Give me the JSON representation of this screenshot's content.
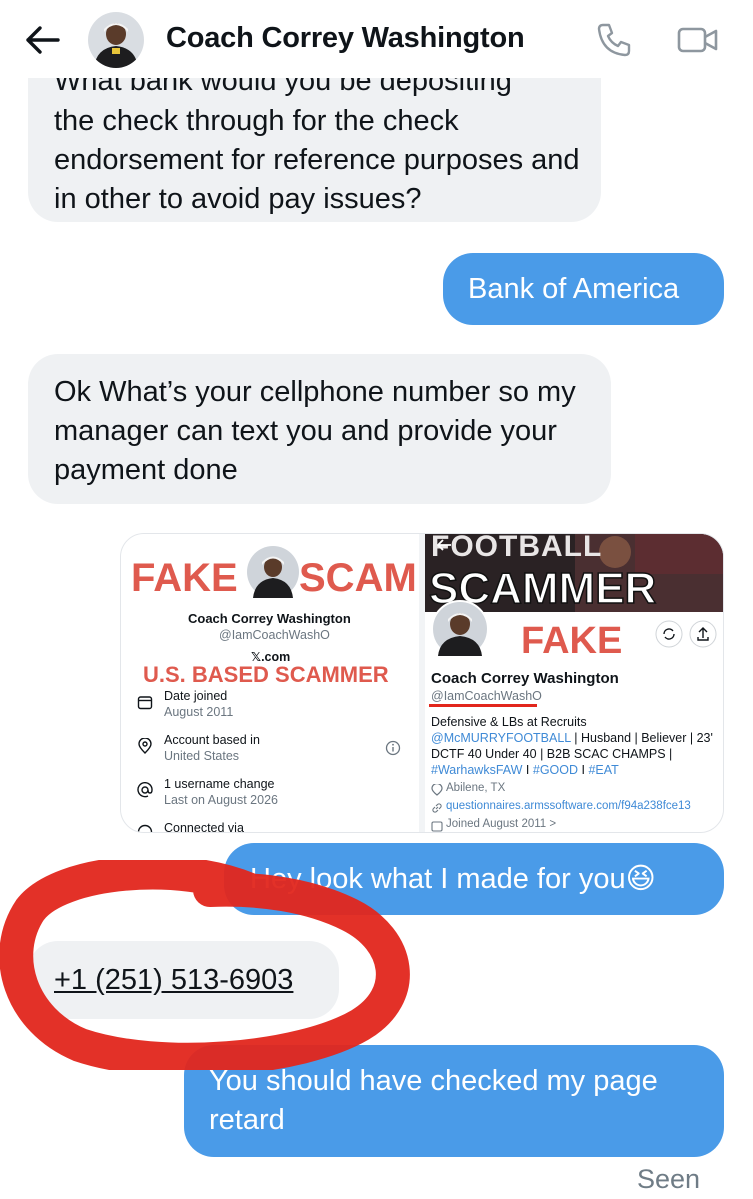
{
  "header": {
    "title": "Coach Correy Washington"
  },
  "messages": {
    "incoming_1_cutoff": "What bank would you be depositing",
    "incoming_1_text": "the check through for the check endorsement for reference purposes and in other to avoid pay issues?",
    "outgoing_1": "Bank of America",
    "incoming_2": "Ok What’s your cellphone number so my manager can text you and provide your payment done",
    "outgoing_2": "Hey look what I made for you😆",
    "incoming_3": "+1 (251) 513-6903",
    "outgoing_3": "You should have checked my page retard",
    "seen": "Seen"
  },
  "image": {
    "left": {
      "fake": "FAKE",
      "scam": "SCAM",
      "name": "Coach Correy Washington",
      "handle": "@IamCoachWashO",
      "xcom": "𝕏.com",
      "banner": "U.S. BASED SCAMMER",
      "rows": [
        {
          "icon": "calendar-icon",
          "title": "Date joined",
          "value": "August 2011"
        },
        {
          "icon": "location-icon",
          "title": "Account based in",
          "value": "United States"
        },
        {
          "icon": "at-icon",
          "title": "1 username change",
          "value": "Last on August 2026"
        },
        {
          "icon": "shield-icon",
          "title": "Connected via",
          "value": ""
        }
      ]
    },
    "right": {
      "header_text": "FOOTBALL",
      "scammer": "SCAMMER",
      "fake": "FAKE",
      "name": "Coach Correy Washington",
      "handle": "@IamCoachWashO",
      "bio_1": "Defensive & LBs at Recruits",
      "bio_2_link": "@McMURRYFOOTBALL",
      "bio_2_rest": " | Husband | Believer | 23'",
      "bio_3": "DCTF 40 Under 40 | B2B SCAC CHAMPS |",
      "bio_4_a": "#WarhawksFAW",
      "bio_4_b": " I ",
      "bio_4_c": "#GOOD",
      "bio_4_d": " I ",
      "bio_4_e": "#EAT",
      "location": "Abilene, TX",
      "link": "questionnaires.armssoftware.com/f94a238fce13",
      "joined": "Joined August 2011 >"
    }
  },
  "colors": {
    "outgoing": "#4a9be8",
    "incoming": "#eff1f3",
    "annotation": "#e2261c",
    "fake_red": "#df5a4e"
  }
}
